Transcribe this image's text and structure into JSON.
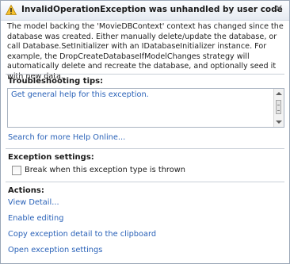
{
  "title": "InvalidOperationException was unhandled by user code",
  "message": "The model backing the 'MovieDBContext' context has changed since the database was created. Either manually delete/update the database, or call Database.SetInitializer with an IDatabaseInitializer instance. For example, the DropCreateDatabaseIfModelChanges strategy will automatically delete and recreate the database, and optionally seed it with new data.",
  "troubleshooting": {
    "heading": "Troubleshooting tips:",
    "tips": [
      "Get general help for this exception."
    ],
    "search_link": "Search for more Help Online..."
  },
  "exception_settings": {
    "heading": "Exception settings:",
    "checkbox_label": "Break when this exception type is thrown",
    "checked": false
  },
  "actions": {
    "heading": "Actions:",
    "items": [
      "View Detail...",
      "Enable editing",
      "Copy exception detail to the clipboard",
      "Open exception settings"
    ]
  },
  "icons": {
    "title_icon": "warning-icon",
    "close": "close-icon"
  },
  "colors": {
    "link": "#2a62b8",
    "warning": "#f5c12e"
  }
}
